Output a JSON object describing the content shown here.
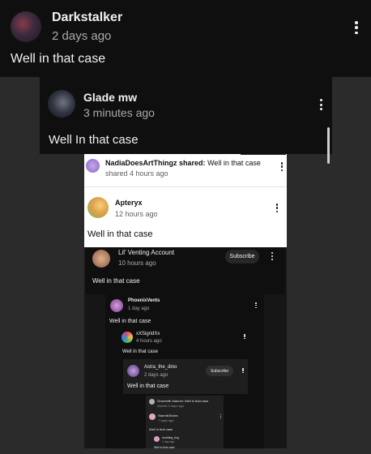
{
  "post1": {
    "username": "Darkstalker",
    "time": "2 days ago",
    "text": "Well in that case"
  },
  "post2": {
    "username": "Glade mw",
    "time": "3 minutes ago",
    "text": "Well In that case"
  },
  "post3": {
    "username": "NadiaDoesArtThingz",
    "shared_label": "shared:",
    "shared_text": "Well in that case",
    "time": "shared 4 hours ago"
  },
  "post4": {
    "username": "Apteryx",
    "time": "12 hours ago",
    "text": "Well in that case"
  },
  "post5": {
    "username": "Lil' Venting Account",
    "time": "10 hours ago",
    "text": "Well in that case",
    "subscribe": "Subscribe"
  },
  "post6": {
    "username": "PhoenixVents",
    "time": "1 day ago",
    "text": "Well in that case"
  },
  "post7": {
    "username": "xXSigridXx",
    "time": "4 hours ago",
    "text": "Well in that case"
  },
  "post8": {
    "username": "Astra_the_dino",
    "time": "2 days ago",
    "text": "Well in that case",
    "subscribe": "Subscribe"
  },
  "post9": {
    "username": "Gravers♥ channel:",
    "shared_text": "Well in that case",
    "time": "shared 2 days ago"
  },
  "post10": {
    "username": "StarmikStoles",
    "time": "7 days ago",
    "text": "Well in that case"
  },
  "post11": {
    "username": "doubling_ting",
    "time": "1 day ago",
    "text": "Well in that case"
  },
  "colors": {
    "dark_bg": "#0f0f0f",
    "page_bg": "#2b2b2b",
    "white_card": "#ffffff"
  }
}
